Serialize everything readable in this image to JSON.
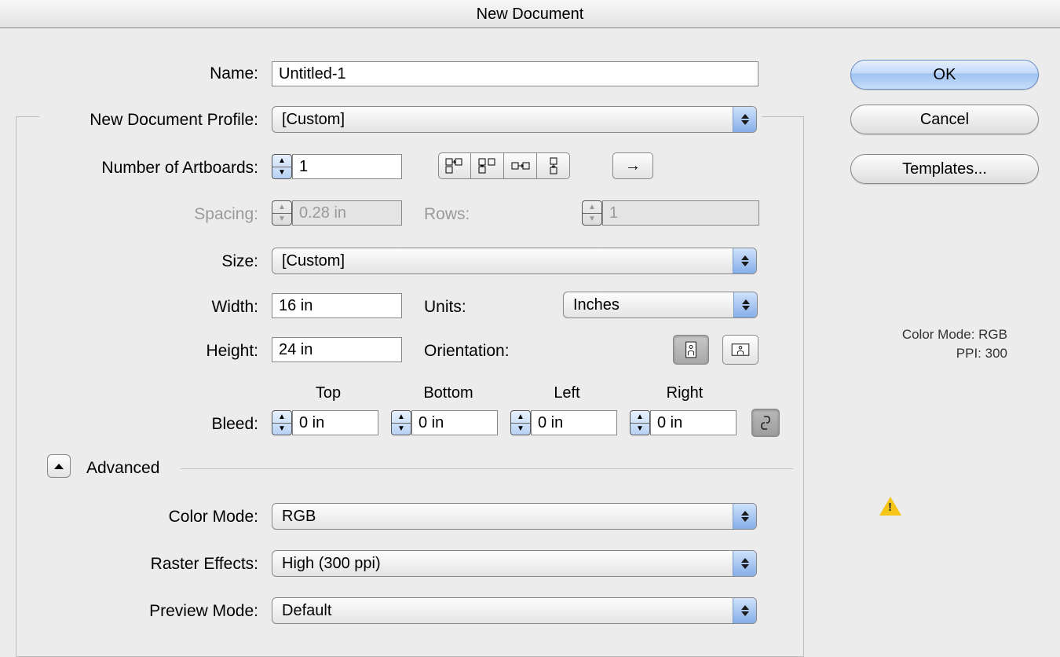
{
  "dialog": {
    "title": "New Document"
  },
  "labels": {
    "name": "Name:",
    "profile": "New Document Profile:",
    "artboards": "Number of Artboards:",
    "spacing": "Spacing:",
    "rows": "Rows:",
    "size": "Size:",
    "width": "Width:",
    "units": "Units:",
    "height": "Height:",
    "orientation": "Orientation:",
    "bleed": "Bleed:",
    "top": "Top",
    "bottom": "Bottom",
    "left": "Left",
    "right": "Right",
    "advanced": "Advanced",
    "color_mode": "Color Mode:",
    "raster_effects": "Raster Effects:",
    "preview_mode": "Preview Mode:"
  },
  "fields": {
    "name": "Untitled-1",
    "profile": "[Custom]",
    "artboards": "1",
    "spacing": "0.28 in",
    "rows": "1",
    "size": "[Custom]",
    "width": "16 in",
    "height": "24 in",
    "units": "Inches",
    "bleed_top": "0 in",
    "bleed_bottom": "0 in",
    "bleed_left": "0 in",
    "bleed_right": "0 in",
    "color_mode": "RGB",
    "raster_effects": "High (300 ppi)",
    "preview_mode": "Default"
  },
  "buttons": {
    "ok": "OK",
    "cancel": "Cancel",
    "templates": "Templates..."
  },
  "side": {
    "line1": "Color Mode: RGB",
    "line2": "PPI: 300"
  }
}
